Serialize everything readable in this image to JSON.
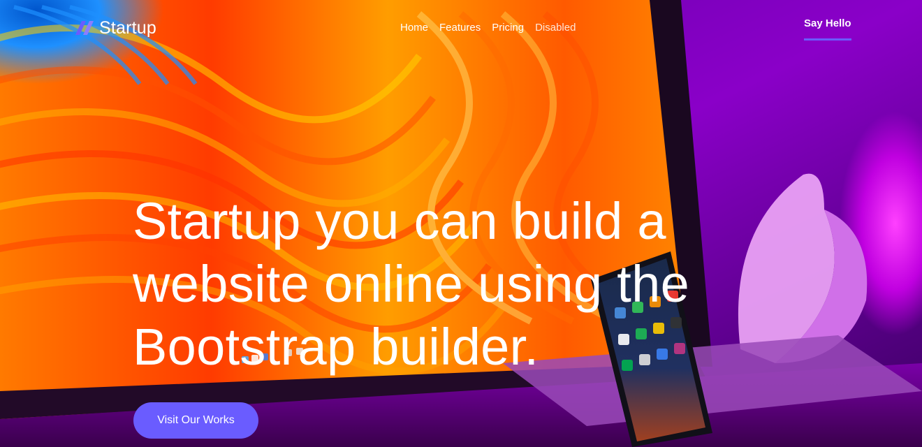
{
  "brand": {
    "name": "Startup",
    "logo_icon": "double-slash-logo-icon",
    "accent_color": "#6a5cff"
  },
  "nav": {
    "links": [
      {
        "label": "Home"
      },
      {
        "label": "Features"
      },
      {
        "label": "Pricing"
      },
      {
        "label": "Disabled",
        "disabled": true
      }
    ],
    "cta_label": "Say Hello"
  },
  "hero": {
    "headline": "Startup you can build a website online using the Bootstrap builder.",
    "button_label": "Visit Our Works",
    "background": "colorful-wave-wallpaper-on-monitor-with-phone-and-purple-lamp"
  }
}
